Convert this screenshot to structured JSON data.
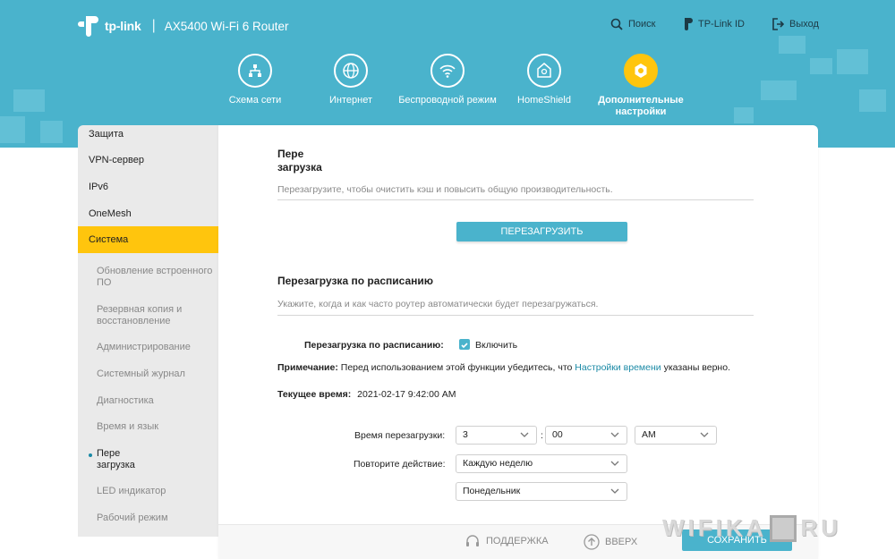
{
  "header": {
    "brand": "tp-link",
    "separator": "|",
    "model": "AX5400 Wi-Fi 6 Router",
    "links": [
      {
        "label": "Поиск",
        "icon": "search-icon"
      },
      {
        "label": "TP-Link ID",
        "icon": "tplink-id-icon"
      },
      {
        "label": "Выход",
        "icon": "logout-icon"
      }
    ]
  },
  "nav": [
    {
      "label": "Схема сети",
      "icon": "network-map-icon"
    },
    {
      "label": "Интернет",
      "icon": "globe-icon"
    },
    {
      "label": "Беспроводной режим",
      "icon": "wifi-icon"
    },
    {
      "label": "HomeShield",
      "icon": "home-shield-icon"
    },
    {
      "label": "Дополнительные настройки",
      "icon": "gear-icon",
      "active": true
    }
  ],
  "sidebar": {
    "items": [
      "Защита",
      "VPN-сервер",
      "IPv6",
      "OneMesh",
      "Система"
    ],
    "active": "Система",
    "sub": [
      "Обновление встроенного ПО",
      "Резервная копия и восстановление",
      "Администрирование",
      "Системный журнал",
      "Диагностика",
      "Время и язык",
      "Пере загрузка",
      "LED индикатор",
      "Рабочий режим"
    ],
    "current": "Пере загрузка"
  },
  "reboot": {
    "title": "Пере загрузка",
    "description": "Перезагрузите, чтобы очистить кэш и повысить общую производительность.",
    "button": "ПЕРЕЗАГРУЗИТЬ"
  },
  "schedule": {
    "title": "Перезагрузка по расписанию",
    "description": "Укажите, когда и как часто роутер автоматически будет перезагружаться.",
    "toggle_label": "Перезагрузка по расписанию:",
    "toggle_value": "Включить",
    "note_label": "Примечание:",
    "note_text": "Перед использованием этой функции убедитесь, что",
    "note_link": "Настройки времени",
    "note_end": "указаны верно.",
    "current_time_label": "Текущее время:",
    "current_time": "2021-02-17 9:42:00 AM",
    "reboot_time_label": "Время перезагрузки:",
    "hour": "3",
    "colon": ":",
    "minute": "00",
    "ampm": "AM",
    "repeat_label": "Повторите действие:",
    "repeat": "Каждую неделю",
    "day": "Понедельник"
  },
  "footer": {
    "support": "ПОДДЕРЖКА",
    "up": "ВВЕРХ",
    "save": "СОХРАНИТЬ"
  },
  "watermark": {
    "left": "WIFIKA",
    "right": "RU"
  },
  "colors": {
    "accent": "#4ab3cc",
    "active": "#ffc50d"
  }
}
